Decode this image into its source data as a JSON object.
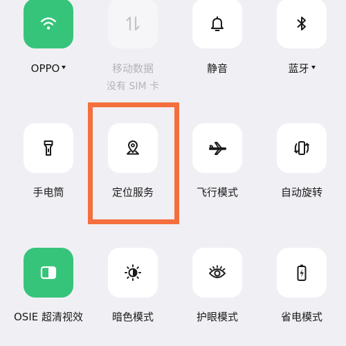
{
  "colors": {
    "background": "#f0f0f4",
    "tile": "#ffffff",
    "tile_active": "#36c47a",
    "highlight": "#f46f3d",
    "text": "#1a1a1a",
    "text_disabled": "#b3b3b8"
  },
  "tiles": [
    {
      "label": "OPPO",
      "icon": "wifi-icon",
      "active": true,
      "dropdown": true
    },
    {
      "label": "移动数据",
      "sublabel": "没有 SIM 卡",
      "icon": "mobile-data-icon",
      "disabled": true
    },
    {
      "label": "静音",
      "icon": "bell-icon"
    },
    {
      "label": "蓝牙",
      "icon": "bluetooth-icon",
      "dropdown": true
    },
    {
      "label": "手电筒",
      "icon": "flashlight-icon"
    },
    {
      "label": "定位服务",
      "icon": "location-pin-icon",
      "highlighted": true
    },
    {
      "label": "飞行模式",
      "icon": "airplane-icon"
    },
    {
      "label": "自动旋转",
      "icon": "auto-rotate-icon"
    },
    {
      "label": "OSIE 超清视效",
      "icon": "osie-display-icon",
      "active": true
    },
    {
      "label": "暗色模式",
      "icon": "dark-mode-icon"
    },
    {
      "label": "护眼模式",
      "icon": "eye-protection-icon"
    },
    {
      "label": "省电模式",
      "icon": "battery-saver-icon"
    }
  ]
}
